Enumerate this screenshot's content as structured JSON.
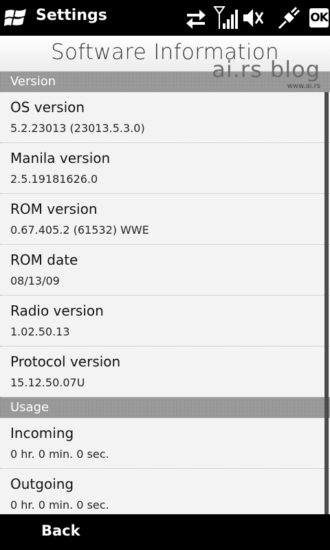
{
  "titlebar": {
    "app_title": "Settings",
    "ok_label": "OK",
    "icons": [
      "windows-logo-icon",
      "data-connection-icon",
      "signal-icon",
      "volume-muted-icon",
      "usb-connection-icon"
    ]
  },
  "page": {
    "title": "Software Information",
    "watermark": "ai.rs blog",
    "watermark_url": "www.ai.rs"
  },
  "sections": [
    {
      "header": "Version",
      "items": [
        {
          "label": "OS version",
          "value": "5.2.23013 (23013.5.3.0)"
        },
        {
          "label": "Manila version",
          "value": "2.5.19181626.0"
        },
        {
          "label": "ROM version",
          "value": "0.67.405.2 (61532) WWE"
        },
        {
          "label": "ROM date",
          "value": "08/13/09"
        },
        {
          "label": "Radio version",
          "value": "1.02.50.13"
        },
        {
          "label": "Protocol version",
          "value": "15.12.50.07U"
        }
      ]
    },
    {
      "header": "Usage",
      "items": [
        {
          "label": "Incoming",
          "value": "0 hr. 0 min. 0 sec."
        },
        {
          "label": "Outgoing",
          "value": "0 hr. 0 min. 0 sec."
        }
      ]
    }
  ],
  "bottombar": {
    "back_label": "Back"
  },
  "colors": {
    "background": "#f3f3f3",
    "section_header": "#9a9a9a",
    "bar": "#000000"
  }
}
